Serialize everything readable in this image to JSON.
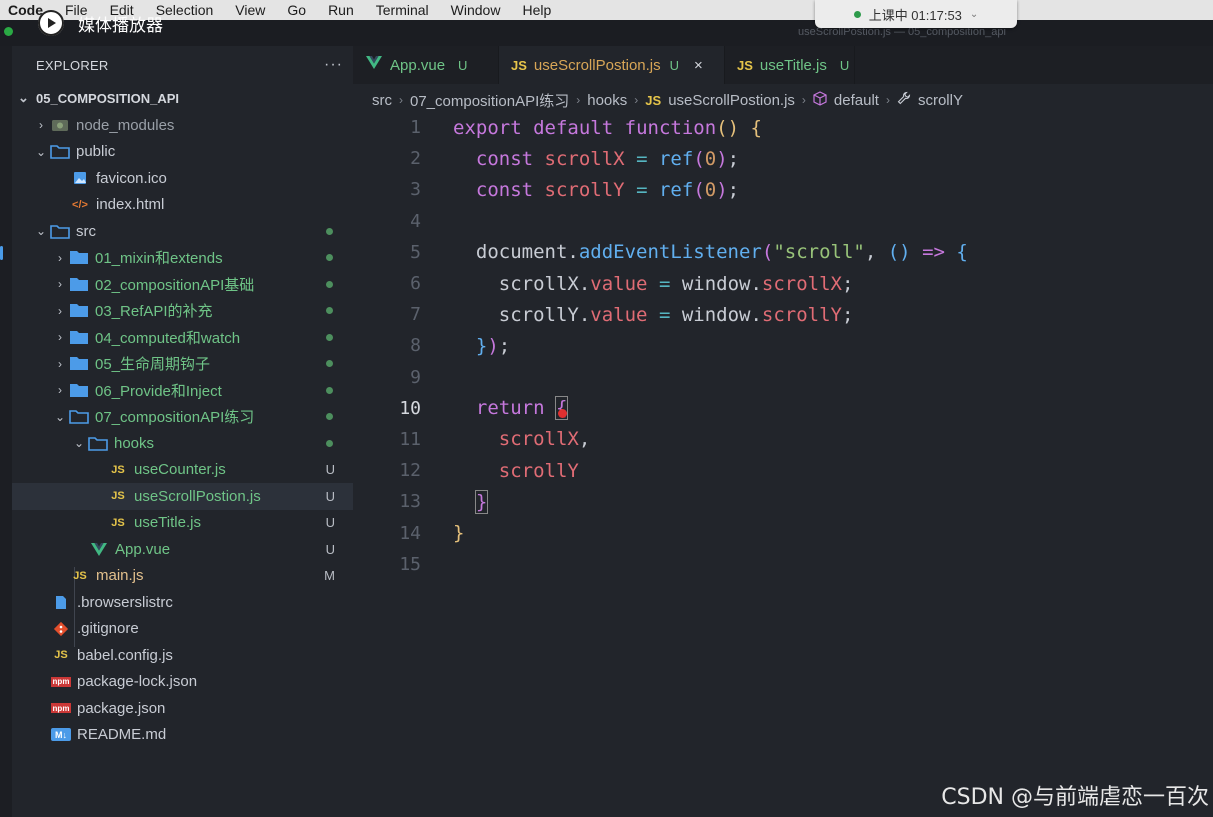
{
  "menubar": {
    "items": [
      "Code",
      "File",
      "Edit",
      "Selection",
      "View",
      "Go",
      "Run",
      "Terminal",
      "Window",
      "Help"
    ]
  },
  "window": {
    "title": "useScrollPostion.js — 05_composition_api"
  },
  "recording": {
    "label": "上课中 01:17:53"
  },
  "media_player": {
    "label": "媒体播放器"
  },
  "explorer": {
    "title": "EXPLORER",
    "more": "···",
    "root": "05_COMPOSITION_API",
    "rows": [
      {
        "label": "node_modules",
        "badge": ""
      },
      {
        "label": "public",
        "badge": ""
      },
      {
        "label": "favicon.ico",
        "badge": ""
      },
      {
        "label": "index.html",
        "badge": ""
      },
      {
        "label": "src",
        "badge": ""
      },
      {
        "label": "01_mixin和extends",
        "badge": ""
      },
      {
        "label": "02_compositionAPI基础",
        "badge": ""
      },
      {
        "label": "03_RefAPI的补充",
        "badge": ""
      },
      {
        "label": "04_computed和watch",
        "badge": ""
      },
      {
        "label": "05_生命周期钩子",
        "badge": ""
      },
      {
        "label": "06_Provide和Inject",
        "badge": ""
      },
      {
        "label": "07_compositionAPI练习",
        "badge": ""
      },
      {
        "label": "hooks",
        "badge": ""
      },
      {
        "label": "useCounter.js",
        "badge": "U"
      },
      {
        "label": "useScrollPostion.js",
        "badge": "U"
      },
      {
        "label": "useTitle.js",
        "badge": "U"
      },
      {
        "label": "App.vue",
        "badge": "U"
      },
      {
        "label": "main.js",
        "badge": "M"
      },
      {
        "label": ".browserslistrc",
        "badge": ""
      },
      {
        "label": ".gitignore",
        "badge": ""
      },
      {
        "label": "babel.config.js",
        "badge": ""
      },
      {
        "label": "package-lock.json",
        "badge": ""
      },
      {
        "label": "package.json",
        "badge": ""
      },
      {
        "label": "README.md",
        "badge": ""
      }
    ]
  },
  "tabs": [
    {
      "label": "App.vue",
      "status": "U"
    },
    {
      "label": "useScrollPostion.js",
      "status": "U",
      "close": "×"
    },
    {
      "label": "useTitle.js",
      "status": "U"
    }
  ],
  "icons": {
    "js": "JS",
    "npm": "npm",
    "md": "M↓",
    "vue": "vue-logo",
    "folder": "folder-icon",
    "image": "image-icon",
    "html": "</>",
    "git": "git-icon",
    "file": "file-icon"
  },
  "breadcrumbs": [
    "src",
    "07_compositionAPI练习",
    "hooks",
    "useScrollPostion.js",
    "default",
    "scrollY"
  ],
  "editor": {
    "current_line": 10,
    "line_numbers": [
      "1",
      "2",
      "3",
      "4",
      "5",
      "6",
      "7",
      "8",
      "9",
      "10",
      "11",
      "12",
      "13",
      "14",
      "15"
    ]
  },
  "watermark": "CSDN @与前端虐恋一百次",
  "colors": {
    "keyword": "#c678dd",
    "function": "#61afef",
    "variable": "#e06c75",
    "number": "#d19a66",
    "string": "#98c379",
    "untracked": "#6fc487"
  }
}
